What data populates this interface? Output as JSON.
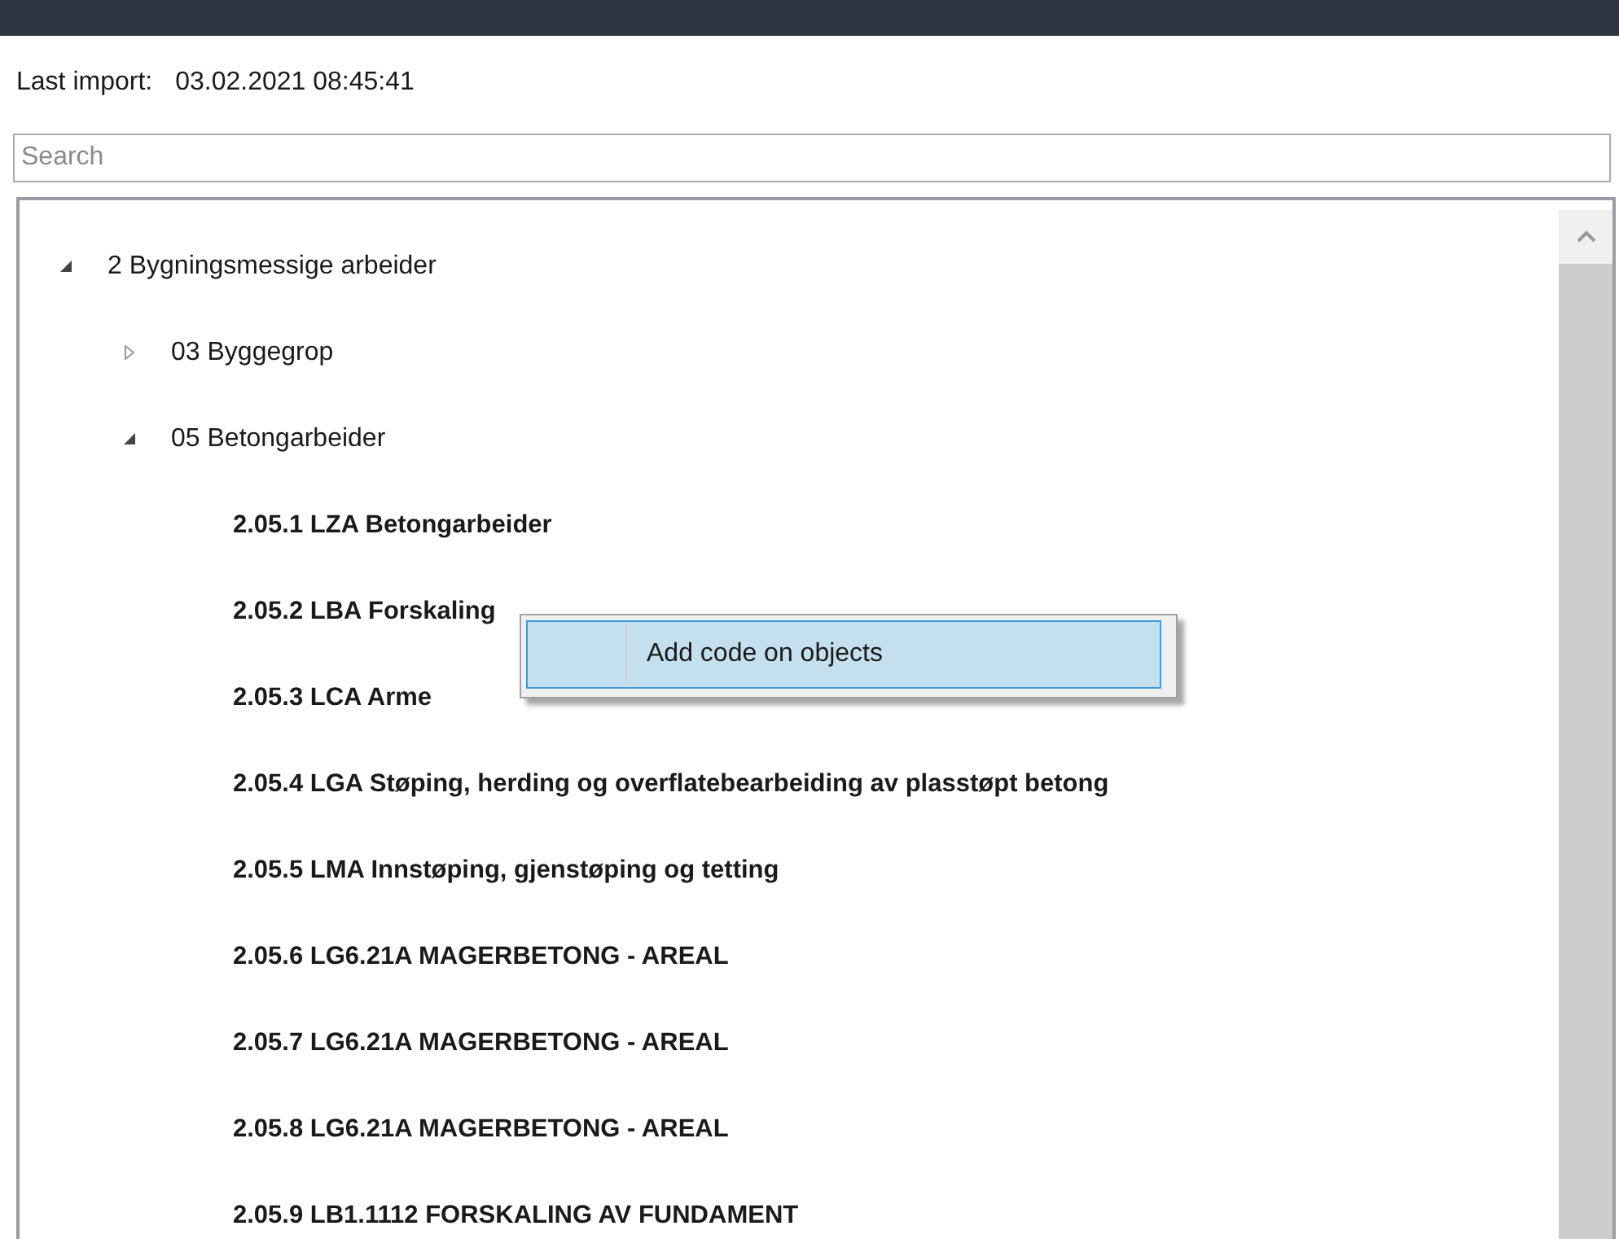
{
  "last_import": {
    "label": "Last import:",
    "value": "03.02.2021 08:45:41"
  },
  "search": {
    "placeholder": "Search"
  },
  "tree": [
    {
      "kind": "group",
      "label": "2 Bygningsmessige arbeider",
      "expanded": true,
      "children": [
        {
          "kind": "group",
          "label": "03 Byggegrop",
          "expanded": false
        },
        {
          "kind": "group",
          "label": "05 Betongarbeider",
          "expanded": true,
          "children": [
            {
              "kind": "code",
              "label": "2.05.1 LZA Betongarbeider"
            },
            {
              "kind": "code",
              "label": "2.05.2 LBA Forskaling"
            },
            {
              "kind": "code",
              "label": "2.05.3 LCA Arme"
            },
            {
              "kind": "code",
              "label": "2.05.4 LGA Støping, herding og overflatebearbeiding av plasstøpt betong"
            },
            {
              "kind": "code",
              "label": "2.05.5 LMA Innstøping, gjenstøping og tetting"
            },
            {
              "kind": "code",
              "label": "2.05.6 LG6.21A MAGERBETONG - AREAL"
            },
            {
              "kind": "code",
              "label": "2.05.7 LG6.21A MAGERBETONG - AREAL"
            },
            {
              "kind": "code",
              "label": "2.05.8 LG6.21A MAGERBETONG - AREAL"
            },
            {
              "kind": "code",
              "label": "2.05.9 LB1.1112 FORSKALING AV FUNDAMENT"
            }
          ]
        }
      ]
    }
  ],
  "context_menu": [
    {
      "label": "Add code on objects",
      "selected": true
    }
  ]
}
